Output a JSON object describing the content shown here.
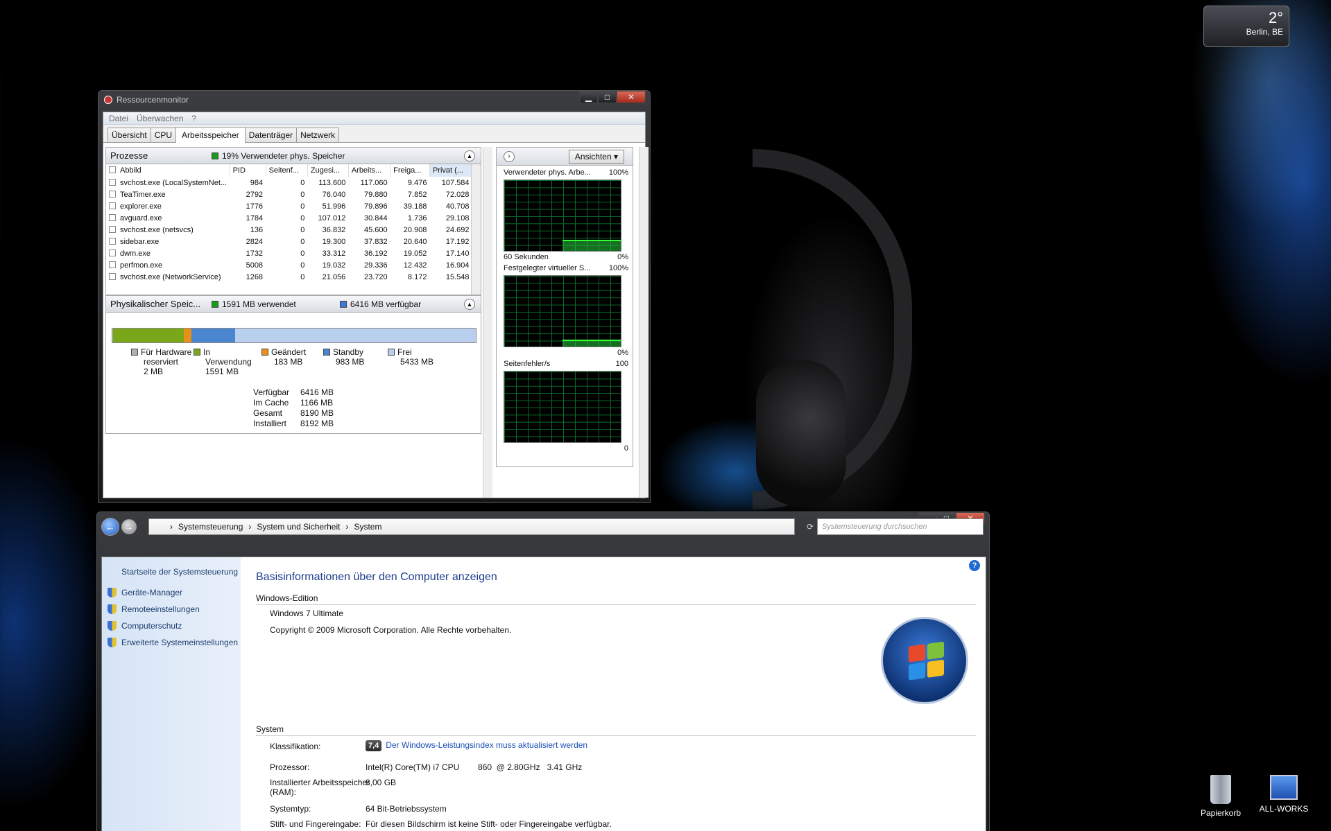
{
  "weather": {
    "temp": "2°",
    "city": "Berlin, BE"
  },
  "resmon": {
    "title": "Ressourcenmonitor",
    "menu": [
      "Datei",
      "Überwachen",
      "?"
    ],
    "tabs": [
      "Übersicht",
      "CPU",
      "Arbeitsspeicher",
      "Datenträger",
      "Netzwerk"
    ],
    "active_tab": "Arbeitsspeicher",
    "processes": {
      "title": "Prozesse",
      "summary": "19% Verwendeter phys. Speicher",
      "columns": [
        "Abbild",
        "PID",
        "Seitenf...",
        "Zugesi...",
        "Arbeits...",
        "Freiga...",
        "Privat (..."
      ],
      "rows": [
        [
          "svchost.exe (LocalSystemNet...",
          "984",
          "0",
          "113.600",
          "117.060",
          "9.476",
          "107.584"
        ],
        [
          "TeaTimer.exe",
          "2792",
          "0",
          "76.040",
          "79.880",
          "7.852",
          "72.028"
        ],
        [
          "explorer.exe",
          "1776",
          "0",
          "51.996",
          "79.896",
          "39.188",
          "40.708"
        ],
        [
          "avguard.exe",
          "1784",
          "0",
          "107.012",
          "30.844",
          "1.736",
          "29.108"
        ],
        [
          "svchost.exe (netsvcs)",
          "136",
          "0",
          "36.832",
          "45.600",
          "20.908",
          "24.692"
        ],
        [
          "sidebar.exe",
          "2824",
          "0",
          "19.300",
          "37.832",
          "20.640",
          "17.192"
        ],
        [
          "dwm.exe",
          "1732",
          "0",
          "33.312",
          "36.192",
          "19.052",
          "17.140"
        ],
        [
          "perfmon.exe",
          "5008",
          "0",
          "19.032",
          "29.336",
          "12.432",
          "16.904"
        ],
        [
          "svchost.exe (NetworkService)",
          "1268",
          "0",
          "21.056",
          "23.720",
          "8.172",
          "15.548"
        ]
      ]
    },
    "physical": {
      "title": "Physikalischer Speic...",
      "used": "1591 MB verwendet",
      "available": "6416 MB verfügbar",
      "bar": [
        {
          "label": "Für Hardware reserviert",
          "value": "2 MB",
          "mb": 2,
          "color": "#b0b0b0"
        },
        {
          "label": "In Verwendung",
          "value": "1591 MB",
          "mb": 1591,
          "color": "#7aa619"
        },
        {
          "label": "Geändert",
          "value": "183 MB",
          "mb": 183,
          "color": "#e8901a"
        },
        {
          "label": "Standby",
          "value": "983 MB",
          "mb": 983,
          "color": "#4a86d0"
        },
        {
          "label": "Frei",
          "value": "5433 MB",
          "mb": 5433,
          "color": "#b8d0ee"
        }
      ],
      "legend_lines": [
        [
          "Für Hardware",
          "reserviert",
          "2 MB"
        ],
        [
          "In",
          "Verwendung",
          "1591 MB"
        ],
        [
          "Geändert",
          "183 MB"
        ],
        [
          "Standby",
          "983 MB"
        ],
        [
          "Frei",
          "5433 MB"
        ]
      ],
      "stats": [
        [
          "Verfügbar",
          "6416 MB"
        ],
        [
          "Im Cache",
          "1166 MB"
        ],
        [
          "Gesamt",
          "8190 MB"
        ],
        [
          "Installiert",
          "8192 MB"
        ]
      ]
    },
    "view_button": "Ansichten",
    "graphs": [
      {
        "label": "Verwendeter phys. Arbe...",
        "max": "100%",
        "bottom_left": "60 Sekunden",
        "bottom_right": "0%"
      },
      {
        "label": "Festgelegter virtueller S...",
        "max": "100%",
        "bottom_left": "",
        "bottom_right": "0%"
      },
      {
        "label": "Seitenfehler/s",
        "max": "100",
        "bottom_left": "",
        "bottom_right": "0"
      }
    ]
  },
  "system": {
    "breadcrumb": [
      "Systemsteuerung",
      "System und Sicherheit",
      "System"
    ],
    "search_placeholder": "Systemsteuerung durchsuchen",
    "sidebar": {
      "home": "Startseite der Systemsteuerung",
      "links": [
        "Geräte-Manager",
        "Remoteeinstellungen",
        "Computerschutz",
        "Erweiterte Systemeinstellungen"
      ]
    },
    "heading": "Basisinformationen über den Computer anzeigen",
    "edition_title": "Windows-Edition",
    "edition": "Windows 7 Ultimate",
    "copyright": "Copyright © 2009 Microsoft Corporation. Alle Rechte vorbehalten.",
    "system_title": "System",
    "rating_label": "Klassifikation:",
    "rating_score": "7,4",
    "rating_link": "Der Windows-Leistungsindex muss aktualisiert werden",
    "cpu_label": "Prozessor:",
    "cpu": "Intel(R) Core(TM) i7 CPU        860  @ 2.80GHz   3.41 GHz",
    "ram_label": "Installierter Arbeitsspeicher (RAM):",
    "ram": "8,00 GB",
    "type_label": "Systemtyp:",
    "type": "64 Bit-Betriebssystem",
    "pen_label": "Stift- und Fingereingabe:",
    "pen": "Für diesen Bildschirm ist keine Stift- oder Fingereingabe verfügbar."
  },
  "desktop": {
    "icons": [
      "Papierkorb",
      "ALL-WORKS"
    ]
  }
}
